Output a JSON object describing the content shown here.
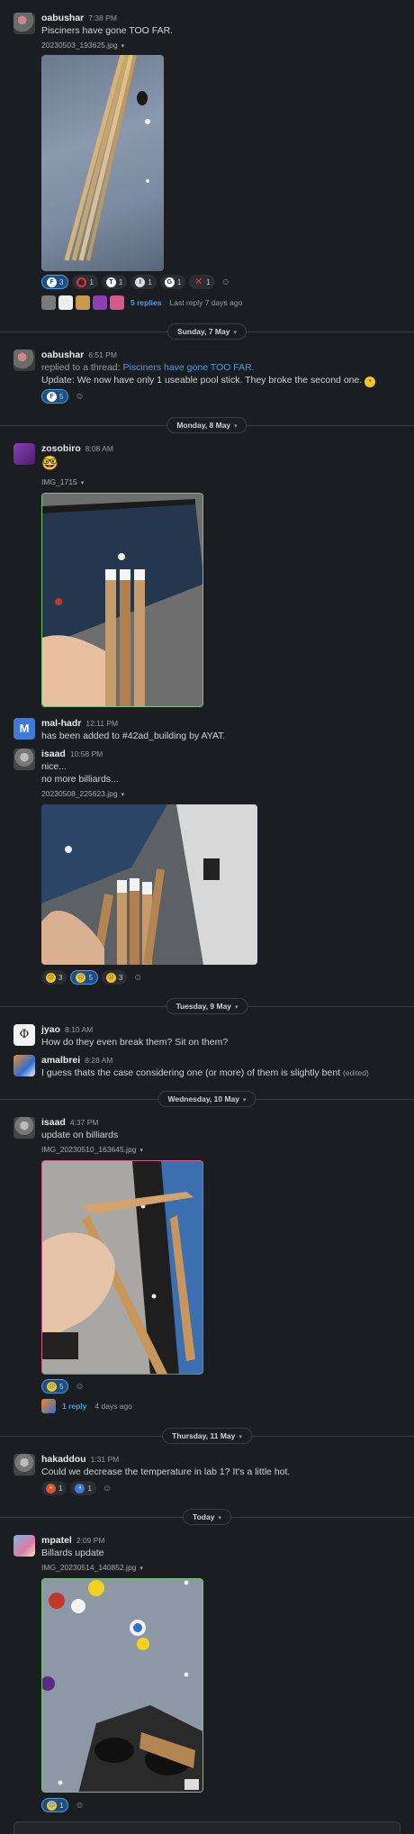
{
  "messages": [
    {
      "user": "oabushar",
      "time": "7:38 PM",
      "text": "Pisciners have gone TOO FAR.",
      "file": "20230503_193625.jpg",
      "reactions": [
        {
          "icon": "f-badge",
          "count": "3",
          "mine": true
        },
        {
          "icon": "no-entry",
          "count": "1"
        },
        {
          "icon": "t-badge",
          "count": "1"
        },
        {
          "icon": "i-badge",
          "count": "1"
        },
        {
          "icon": "g-badge",
          "count": "1"
        },
        {
          "icon": "x-mark",
          "count": "1"
        }
      ],
      "thread": {
        "replies": "5 replies",
        "last": "Last reply 7 days ago"
      }
    },
    {
      "user": "oabushar",
      "time": "6:51 PM",
      "replied_prefix": "replied to a thread:",
      "replied_link": "Pisciners have gone TOO FAR.",
      "text": "Update: We now have only 1 useable pool stick. They broke the second one.",
      "reactions": [
        {
          "icon": "f-badge",
          "count": "5",
          "mine": true
        }
      ]
    },
    {
      "user": "zosobiro",
      "time": "8:08 AM",
      "emoji": "🤓",
      "file": "IMG_1715"
    },
    {
      "user": "mal-hadr",
      "avatar_letter": "M",
      "time": "12:11 PM",
      "text": "has been added to #42ad_building by AYAT."
    },
    {
      "user": "isaad",
      "time": "10:58 PM",
      "text": "nice...",
      "text2": "no more billiards...",
      "file": "20230508_225623.jpg",
      "reactions": [
        {
          "icon": "sad-face",
          "count": "3"
        },
        {
          "icon": "crying-face",
          "count": "5",
          "mine": true
        },
        {
          "icon": "weary-face",
          "count": "3"
        }
      ]
    },
    {
      "user": "jyao",
      "avatar_letter": "Φ",
      "time": "8:10 AM",
      "text": "How do they even break them? Sit on them?"
    },
    {
      "user": "amalbrei",
      "time": "8:28 AM",
      "text": "I guess thats the case considering one  (or more) of them is slightly bent",
      "edited": "(edited)"
    },
    {
      "user": "isaad",
      "time": "4:37 PM",
      "text": "update on billiards",
      "file": "IMG_20230510_163645.jpg",
      "reactions": [
        {
          "icon": "crying-face",
          "count": "5",
          "mine": true
        }
      ],
      "thread": {
        "replies": "1 reply",
        "last": "4 days ago"
      }
    },
    {
      "user": "hakaddou",
      "time": "1:31 PM",
      "text": "Could we decrease the temperature in lab 1? It's a little hot.",
      "reactions": [
        {
          "icon": "hot-face",
          "count": "1"
        },
        {
          "icon": "cold-face",
          "count": "1"
        }
      ]
    },
    {
      "user": "mpatel",
      "time": "2:09 PM",
      "text": "Billards update",
      "file": "IMG_20230514_140852.jpg",
      "reactions": [
        {
          "icon": "crying-face",
          "count": "1",
          "mine": true
        }
      ]
    }
  ],
  "dates": [
    "Sunday, 7 May",
    "Monday, 8 May",
    "Tuesday, 9 May",
    "Wednesday, 10 May",
    "Thursday, 11 May",
    "Today"
  ],
  "colors": {
    "background": "#1a1d21",
    "link": "#4f9ce0",
    "mine_reaction": "#1d4f84"
  }
}
